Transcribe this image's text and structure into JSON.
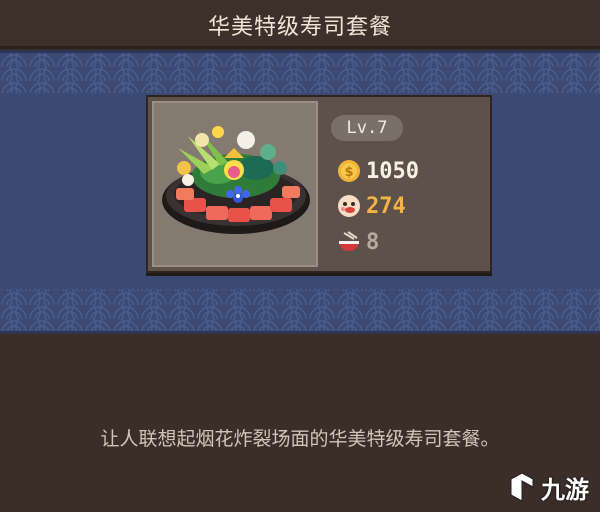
{
  "header": {
    "title": "华美特级寿司套餐"
  },
  "item": {
    "level": "Lv.7",
    "coin_value": "1050",
    "taste_value": "274",
    "bowl_value": "8",
    "icons": {
      "coin": "coin-icon",
      "taste": "taste-face-icon",
      "bowl": "bowl-icon",
      "food": "sushi-platter-icon"
    }
  },
  "description": "让人联想起烟花炸裂场面的华美特级寿司套餐。",
  "watermark": {
    "text": "九游"
  },
  "colors": {
    "band_blue": "#3a4a73",
    "panel_brown": "#3b2e28",
    "coin_value": "#f6f1e4",
    "taste_value": "#f2b545",
    "bowl_value": "#b7aba0"
  }
}
